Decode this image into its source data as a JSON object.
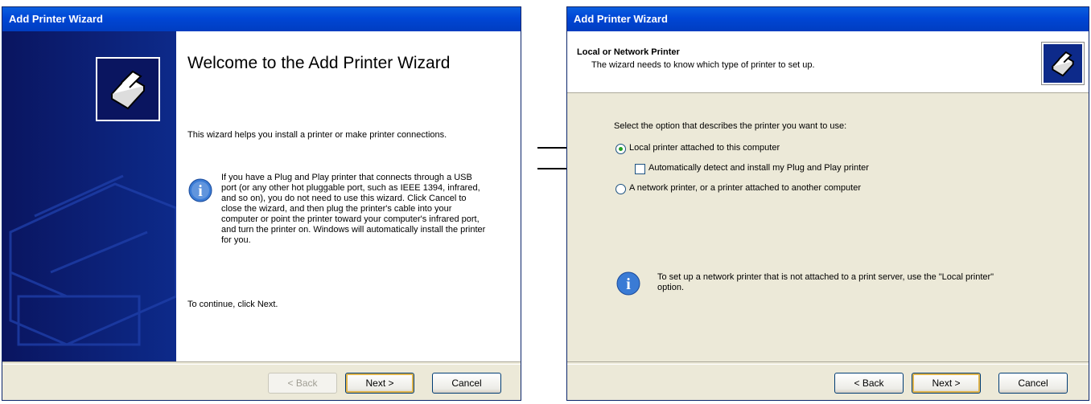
{
  "left_wizard": {
    "title": "Add Printer Wizard",
    "heading": "Welcome to the Add Printer Wizard",
    "intro": "This wizard helps you install a printer or make printer connections.",
    "info": "If you have a Plug and Play printer that connects through a USB port (or any other hot pluggable port, such as IEEE 1394, infrared, and so on), you do not need to use this wizard. Click Cancel to close the wizard, and then plug the printer's cable into your computer or point the printer toward your computer's infrared port, and turn the printer on. Windows will automatically install the printer for you.",
    "continue": "To continue, click Next.",
    "buttons": {
      "back": "< Back",
      "next": "Next >",
      "cancel": "Cancel"
    }
  },
  "right_wizard": {
    "title": "Add Printer Wizard",
    "header_title": "Local or Network Printer",
    "header_subtitle": "The wizard needs to know which type of printer to set up.",
    "prompt": "Select the option that describes the printer you want to use:",
    "options": {
      "local": "Local printer attached to this computer",
      "autodetect": "Automatically detect and install my Plug and Play printer",
      "network": "A network printer, or a printer attached to another computer"
    },
    "selected_option": "local",
    "autodetect_checked": false,
    "info": "To set up a network printer that is not attached to a print server, use the \"Local printer\" option.",
    "buttons": {
      "back": "< Back",
      "next": "Next >",
      "cancel": "Cancel"
    }
  },
  "colors": {
    "titlebar": "#0046d5",
    "sidebar": "#0b1a6e",
    "dialog": "#ece9d8"
  }
}
